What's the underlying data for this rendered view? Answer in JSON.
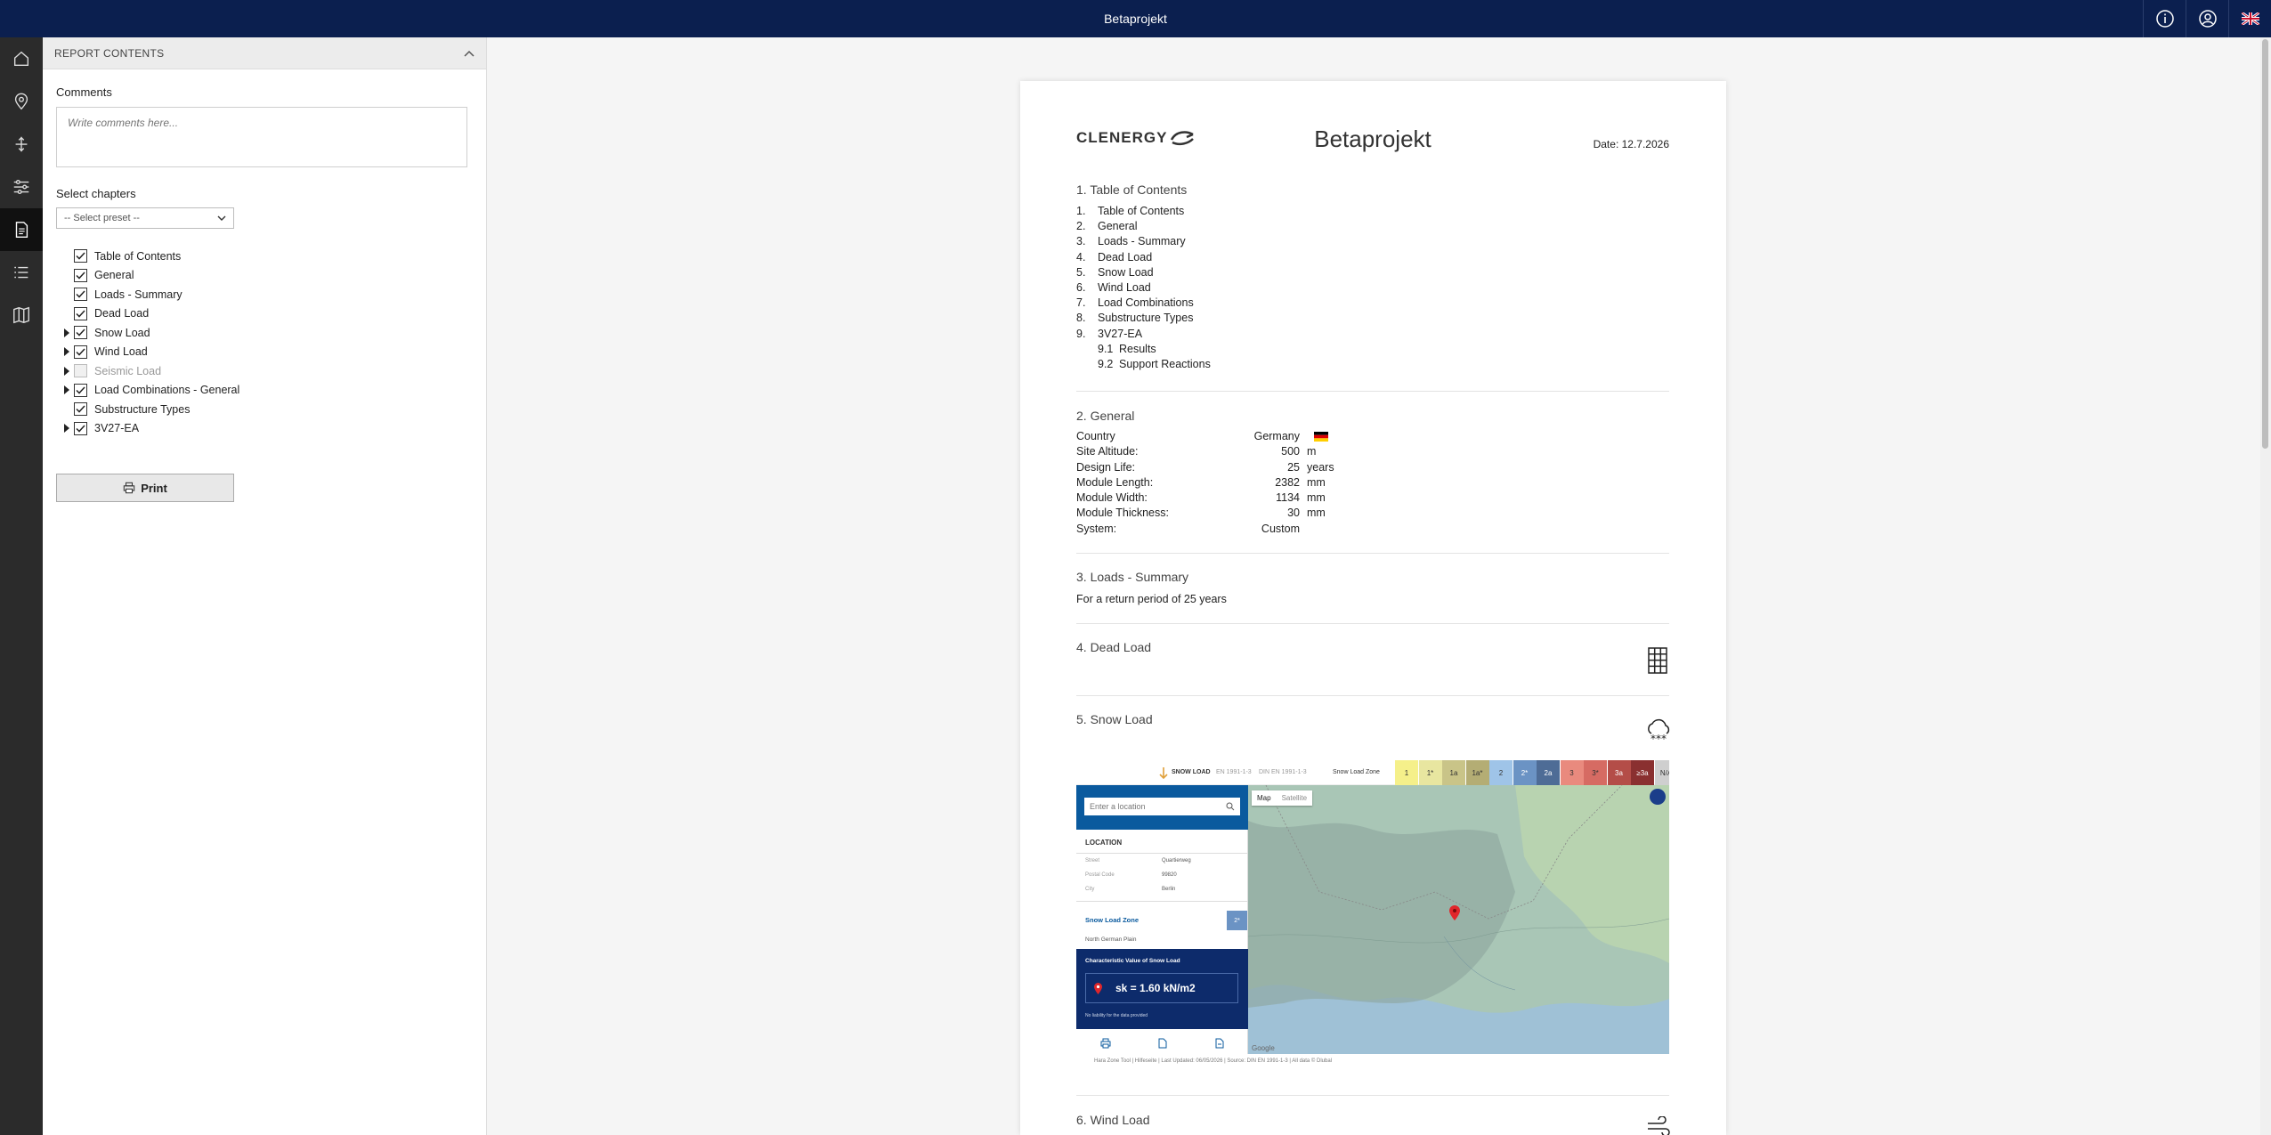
{
  "app": {
    "title": "Betaprojekt"
  },
  "topbar": {
    "info_icon": "info-icon",
    "user_icon": "user-icon",
    "flag": "uk-flag"
  },
  "leftnav": {
    "items": [
      "home-icon",
      "location-pin-icon",
      "structure-icon",
      "sliders-icon",
      "report-icon",
      "list-icon",
      "map-icon"
    ],
    "active": 4
  },
  "panel": {
    "header": "REPORT CONTENTS",
    "comments_label": "Comments",
    "comments_placeholder": "Write comments here...",
    "chapters_label": "Select chapters",
    "preset": "-- Select preset --",
    "chapters": [
      {
        "label": "Table of Contents",
        "checked": true,
        "expandable": false,
        "enabled": true
      },
      {
        "label": "General",
        "checked": true,
        "expandable": false,
        "enabled": true
      },
      {
        "label": "Loads - Summary",
        "checked": true,
        "expandable": false,
        "enabled": true
      },
      {
        "label": "Dead Load",
        "checked": true,
        "expandable": false,
        "enabled": true
      },
      {
        "label": "Snow Load",
        "checked": true,
        "expandable": true,
        "enabled": true
      },
      {
        "label": "Wind Load",
        "checked": true,
        "expandable": true,
        "enabled": true
      },
      {
        "label": "Seismic Load",
        "checked": false,
        "expandable": true,
        "enabled": false
      },
      {
        "label": "Load Combinations - General",
        "checked": true,
        "expandable": true,
        "enabled": true
      },
      {
        "label": "Substructure Types",
        "checked": true,
        "expandable": false,
        "enabled": true
      },
      {
        "label": "3V27-EA",
        "checked": true,
        "expandable": true,
        "enabled": true
      }
    ],
    "print_label": "Print"
  },
  "report": {
    "logo_text": "CLENERGY",
    "title": "Betaprojekt",
    "date": "Date: 12.7.2026",
    "toc": {
      "title": "1. Table of Contents",
      "items": [
        {
          "num": "1.",
          "label": "Table of Contents"
        },
        {
          "num": "2.",
          "label": "General"
        },
        {
          "num": "3.",
          "label": "Loads - Summary"
        },
        {
          "num": "4.",
          "label": "Dead Load"
        },
        {
          "num": "5.",
          "label": "Snow Load"
        },
        {
          "num": "6.",
          "label": "Wind Load"
        },
        {
          "num": "7.",
          "label": "Load Combinations"
        },
        {
          "num": "8.",
          "label": "Substructure Types"
        },
        {
          "num": "9.",
          "label": "3V27-EA"
        }
      ],
      "subitems": [
        {
          "num": "9.1",
          "label": "Results"
        },
        {
          "num": "9.2",
          "label": "Support Reactions"
        }
      ]
    },
    "general": {
      "title": "2. General",
      "rows": [
        {
          "key": "Country",
          "value": "Germany",
          "unit": ""
        },
        {
          "key": "Site Altitude:",
          "value": "500",
          "unit": "m"
        },
        {
          "key": "Design Life:",
          "value": "25",
          "unit": "years"
        },
        {
          "key": "Module Length:",
          "value": "2382",
          "unit": "mm"
        },
        {
          "key": "Module Width:",
          "value": "1134",
          "unit": "mm"
        },
        {
          "key": "Module Thickness:",
          "value": "30",
          "unit": "mm"
        },
        {
          "key": "System:",
          "value": "Custom",
          "unit": ""
        }
      ]
    },
    "loads_summary": {
      "title": "3. Loads - Summary",
      "text": "For a return period of 25 years"
    },
    "dead_load": {
      "title": "4. Dead Load"
    },
    "snow_load": {
      "title": "5. Snow Load",
      "map": {
        "header_brand": "SNOW LOAD",
        "header_norm1": "EN 1991-1-3",
        "header_norm2": "DIN EN 1991-1-3",
        "zone_label": "Snow Load Zone",
        "zones": [
          "1",
          "1*",
          "1a",
          "1a*",
          "2",
          "2*",
          "2a",
          "3",
          "3*",
          "3a",
          "≥3a",
          "N/A"
        ],
        "search_placeholder": "Enter a location",
        "tab_map": "Map",
        "tab_satellite": "Satellite",
        "location_title": "LOCATION",
        "street_label": "Street",
        "street_value": "Quartierweg",
        "postal_label": "Postal Code",
        "postal_value": "99820",
        "city_label": "City",
        "city_value": "Berlin",
        "zone_result_label": "Snow Load Zone",
        "zone_result_value": "2*",
        "region": "North German Plain",
        "char_title": "Characteristic Value of Snow Load",
        "char_value": "sk = 1.60 kN/m2",
        "liability": "No liability for the data provided",
        "google": "Google",
        "footer_text": "Hara Zone Tool | Hilfeseite | Last Updated: 06/05/2026 | Source: DIN EN 1991-1-3 | All data © Dlubal"
      }
    },
    "wind_load": {
      "title": "6. Wind Load"
    }
  }
}
